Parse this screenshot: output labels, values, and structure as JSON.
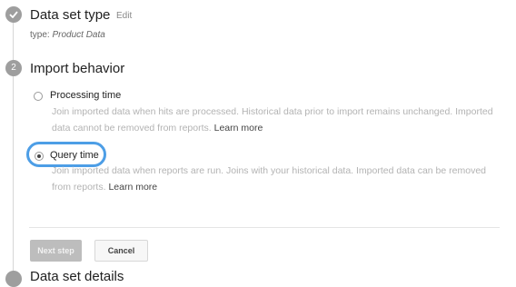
{
  "step1": {
    "title": "Data set type",
    "edit_label": "Edit",
    "type_prefix": "type: ",
    "type_value": "Product Data"
  },
  "step2": {
    "number": "2",
    "title": "Import behavior",
    "options": [
      {
        "label": "Processing time",
        "selected": false,
        "description": "Join imported data when hits are processed. Historical data prior to import remains unchanged. Imported data cannot be removed from reports.",
        "learn_more": "Learn more"
      },
      {
        "label": "Query time",
        "selected": true,
        "description": "Join imported data when reports are run. Joins with your historical data. Imported data can be removed from reports.",
        "learn_more": "Learn more"
      }
    ]
  },
  "buttons": {
    "next": "Next step",
    "cancel": "Cancel"
  },
  "step3": {
    "title": "Data set details"
  },
  "colors": {
    "focus_ring": "#4d9ee6",
    "step_badge": "#9e9e9e",
    "description_text": "#b3b3b3"
  }
}
